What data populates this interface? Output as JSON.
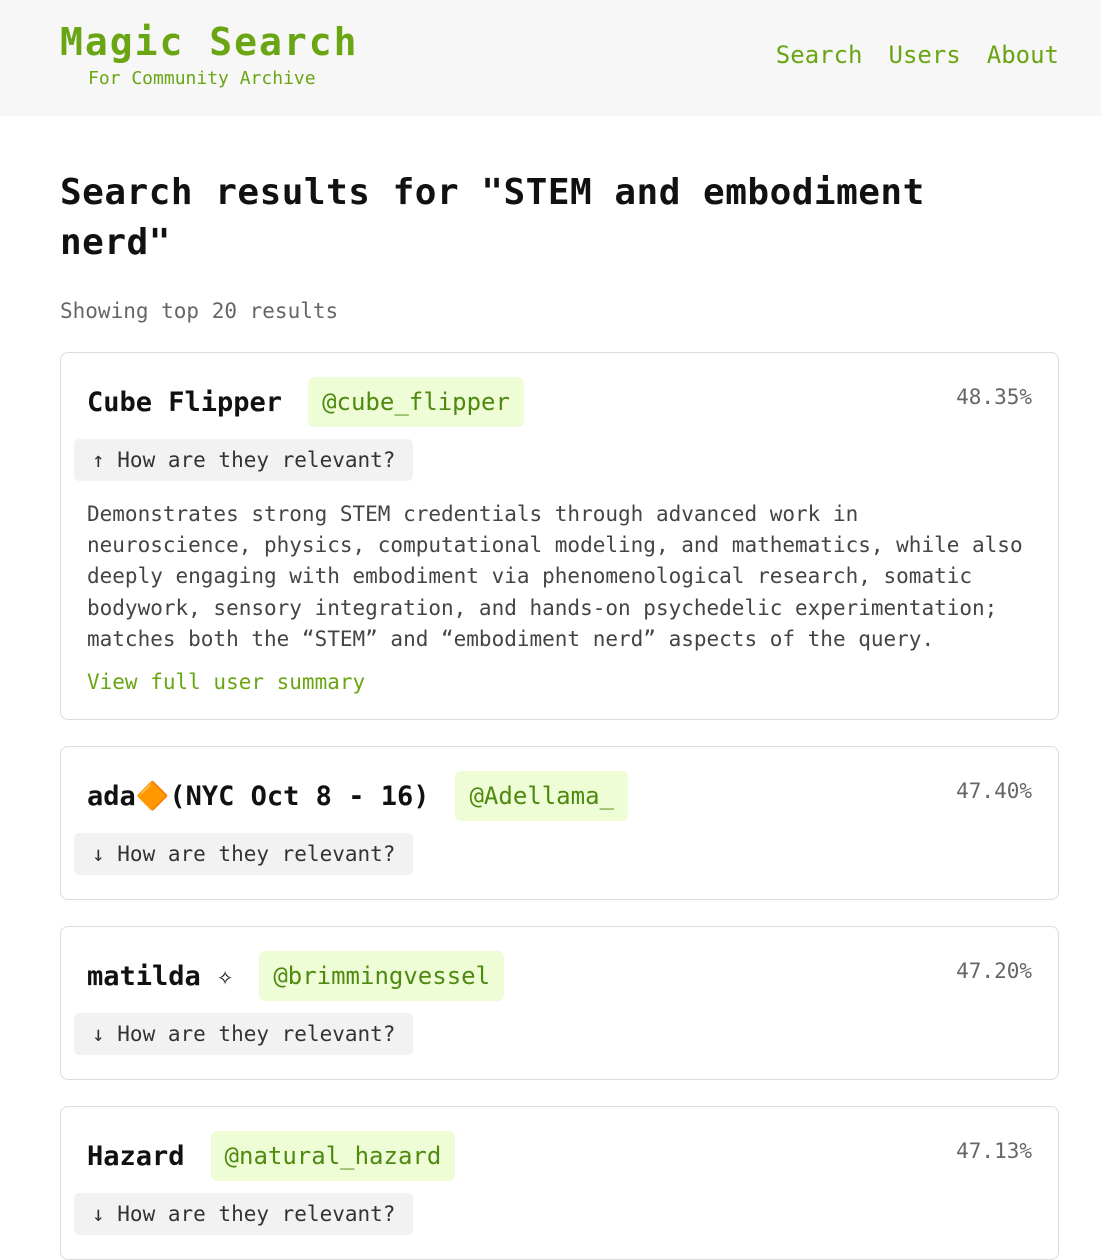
{
  "brand": {
    "title": "Magic Search",
    "subtitle": "For Community Archive"
  },
  "nav": {
    "search": "Search",
    "users": "Users",
    "about": "About"
  },
  "page": {
    "title": "Search results for \"STEM and embodiment nerd\"",
    "subtitle": "Showing top 20 results"
  },
  "results": [
    {
      "name": "Cube Flipper",
      "handle": "@cube_flipper",
      "score": "48.35%",
      "toggle": "↑ How are they relevant?",
      "summary": "Demonstrates strong STEM credentials through advanced work in neuroscience, physics, computational modeling, and mathematics, while also deeply engaging with embodiment via phenomenological research, somatic bodywork, sensory integration, and hands-on psychedelic experimentation; matches both the “STEM” and “embodiment nerd” aspects of the query.",
      "view_link": "View full user summary"
    },
    {
      "name": "ada🔶(NYC Oct 8 - 16)",
      "handle": "@Adellama_",
      "score": "47.40%",
      "toggle": "↓ How are they relevant?"
    },
    {
      "name": "matilda ✧",
      "handle": "@brimmingvessel",
      "score": "47.20%",
      "toggle": "↓ How are they relevant?"
    },
    {
      "name": "Hazard",
      "handle": "@natural_hazard",
      "score": "47.13%",
      "toggle": "↓ How are they relevant?"
    }
  ],
  "colors": {
    "accent": "#6aa514",
    "handle_bg": "#eefdd6",
    "header_bg": "#f7f7f7"
  }
}
